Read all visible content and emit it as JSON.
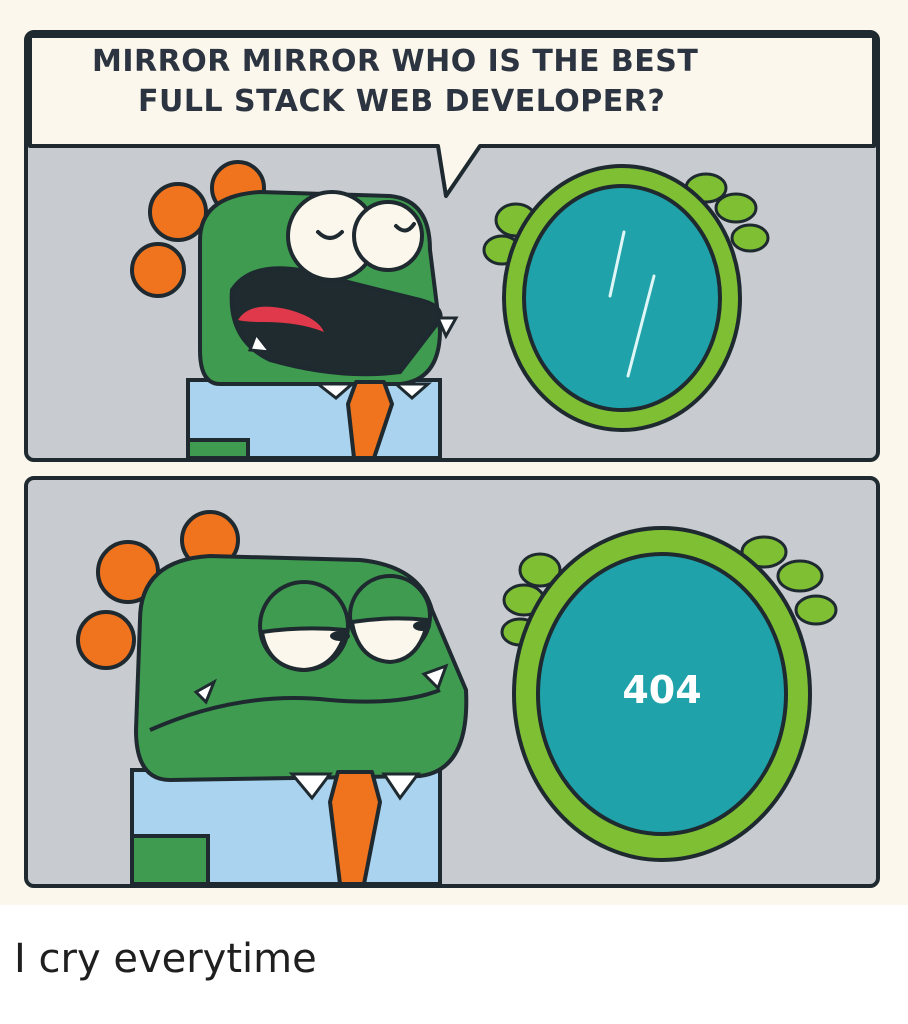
{
  "comic": {
    "speech_line_1": "MIRROR  MIRROR  WHO IS THE BEST",
    "speech_line_2": "FULL STACK WEB DEVELOPER?",
    "mirror_text": "404"
  },
  "caption": "I cry everytime",
  "colors": {
    "panel_bg": "#c8cbd0",
    "monster_green": "#3e9b4f",
    "spikes_orange": "#f0731e",
    "shirt_blue": "#a9d3ef",
    "tie_orange": "#f0731e",
    "mirror_frame": "#7fbf34",
    "mirror_glass": "#1fa2a9",
    "outline": "#1e2a30"
  }
}
